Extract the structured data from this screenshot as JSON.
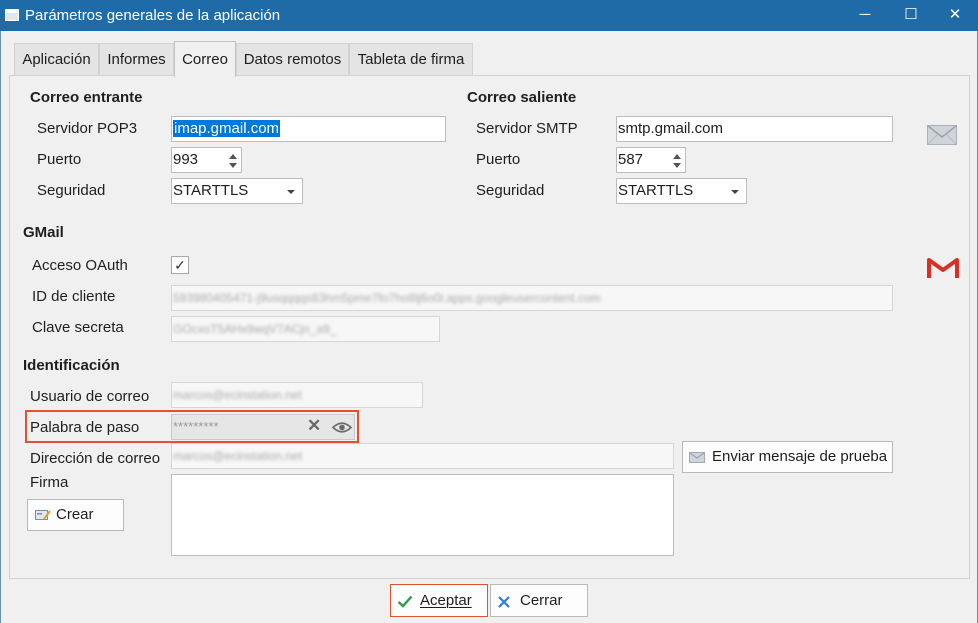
{
  "window": {
    "title": "Parámetros generales de la aplicación",
    "controls": {
      "minimize": "─",
      "maximize": "☐",
      "close": "✕"
    }
  },
  "tabs": [
    {
      "label": "Aplicación",
      "active": false
    },
    {
      "label": "Informes",
      "active": false
    },
    {
      "label": "Correo",
      "active": true
    },
    {
      "label": "Datos remotos",
      "active": false
    },
    {
      "label": "Tableta de firma",
      "active": false
    }
  ],
  "incoming": {
    "header": "Correo entrante",
    "server_label": "Servidor POP3",
    "server_value": "imap.gmail.com",
    "port_label": "Puerto",
    "port_value": "993",
    "security_label": "Seguridad",
    "security_value": "STARTTLS"
  },
  "outgoing": {
    "header": "Correo saliente",
    "server_label": "Servidor SMTP",
    "server_value": "smtp.gmail.com",
    "port_label": "Puerto",
    "port_value": "587",
    "security_label": "Seguridad",
    "security_value": "STARTTLS"
  },
  "gmail": {
    "header": "GMail",
    "oauth_label": "Acceso OAuth",
    "oauth_checked": true,
    "oauth_check_glyph": "✓",
    "client_id_label": "ID de cliente",
    "client_id_value": "593980405471-j9usqqqqs83hm5pme7fo7ho8lj6o0l.apps.googleusercontent.com",
    "secret_label": "Clave secreta",
    "secret_value": "GOcxoT5AHx9wqV7ACjn_a9_"
  },
  "identification": {
    "header": "Identificación",
    "user_label": "Usuario de correo",
    "user_value": "marcos@ecinstation.net",
    "password_label": "Palabra de paso",
    "password_value": "*********",
    "address_label": "Dirección de correo",
    "address_value": "marcos@ecinstation.net",
    "signature_label": "Firma",
    "create_button": "Crear",
    "test_button": "Enviar mensaje de prueba"
  },
  "footer": {
    "accept_button": "Aceptar",
    "close_button": "Cerrar"
  },
  "colors": {
    "titlebar": "#1e6ba8",
    "selection": "#0078d7",
    "highlight": "#e0522b",
    "accept_icon": "#2f9a4a",
    "close_icon": "#2f7bd6",
    "gmail_red": "#d93025"
  }
}
